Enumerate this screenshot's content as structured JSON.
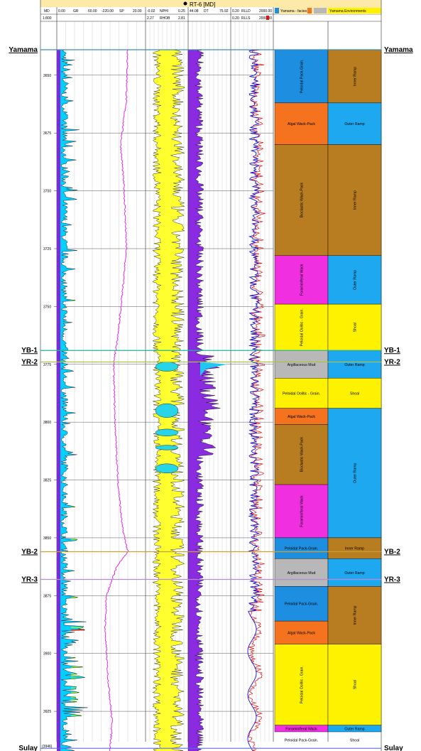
{
  "well": {
    "title": "RT-6 [MD]"
  },
  "header": {
    "md": "MD",
    "scale": "1:800",
    "gr_min": "0.00",
    "gr_name": "GR",
    "gr_max": "60.00",
    "sp_min": "-220.00",
    "sp_name": "SP",
    "sp_max": "20.00",
    "nphi_min": "-0.02",
    "nphi_name": "NPHI",
    "nphi_max": "0.25",
    "rhob_min": "2.27",
    "rhob_name": "RHOB",
    "rhob_max": "2.81",
    "dt_min": "44.08",
    "dt_name": "DT",
    "dt_max": "75.92",
    "rd_min": "0.20",
    "rd_name": "RLLD",
    "rd_max": "2000.00",
    "rs_min": "0.20",
    "rs_name": "RLLS",
    "rs_max": "2000.00",
    "facies_title": "Yamama - facies",
    "env_title": "Yamama Environments"
  },
  "depth_ticks": [
    "3650",
    "3675",
    "3700",
    "3725",
    "3750",
    "3775",
    "3800",
    "3825",
    "3850",
    "3875",
    "3900",
    "3925"
  ],
  "bottom_depth": "(3946)",
  "tops": [
    {
      "name": "Yamama",
      "depth": 3639,
      "color": "#3a8fb0"
    },
    {
      "name": "YB-1",
      "depth": 3769,
      "color": "#21b59a"
    },
    {
      "name": "YR-2",
      "depth": 3774,
      "color": "#a6c24a"
    },
    {
      "name": "YB-2",
      "depth": 3856,
      "color": "#c9a033"
    },
    {
      "name": "YR-3",
      "depth": 3868,
      "color": "#b58ad6"
    },
    {
      "name": "Sulay",
      "depth": 3941,
      "color": "#5b6be0"
    }
  ],
  "facies": [
    {
      "label": "Peloidal Pack-Grain.",
      "from": 3639,
      "to": 3662,
      "color": "#1e8fe0"
    },
    {
      "label": "Algal Wack-Pack",
      "from": 3662,
      "to": 3680,
      "color": "#f5731f"
    },
    {
      "label": "Bioclastic Wack-Pack",
      "from": 3680,
      "to": 3728,
      "color": "#b87d21"
    },
    {
      "label": "Foraminiferal Wack",
      "from": 3728,
      "to": 3749,
      "color": "#ef2fe0"
    },
    {
      "label": "Peloidal Oolitic - Grain.",
      "from": 3749,
      "to": 3769,
      "color": "#fff200"
    },
    {
      "label": "Argillaceous Mud",
      "from": 3769,
      "to": 3781,
      "color": "#b8b8b8"
    },
    {
      "label": "Peloidal Oolitic - Grain.",
      "from": 3781,
      "to": 3794,
      "color": "#fff200"
    },
    {
      "label": "Algal Wack-Pack",
      "from": 3794,
      "to": 3801,
      "color": "#f5731f"
    },
    {
      "label": "Bioclastic Wack-Pack",
      "from": 3801,
      "to": 3827,
      "color": "#b87d21"
    },
    {
      "label": "Foraminiferal Wack",
      "from": 3827,
      "to": 3850,
      "color": "#ef2fe0"
    },
    {
      "label": "Peloidal Pack-Grain.",
      "from": 3850,
      "to": 3859,
      "color": "#1e8fe0"
    },
    {
      "label": "Argillaceous Mud",
      "from": 3859,
      "to": 3871,
      "color": "#b8b8b8"
    },
    {
      "label": "Peloidal Pack-Grain.",
      "from": 3871,
      "to": 3886,
      "color": "#1e8fe0"
    },
    {
      "label": "Algal Wack-Pack",
      "from": 3886,
      "to": 3896,
      "color": "#f5731f"
    },
    {
      "label": "Peloidal Oolitic - Grain.",
      "from": 3896,
      "to": 3931,
      "color": "#fff200"
    },
    {
      "label": "Foraminiferal Wack",
      "from": 3931,
      "to": 3941,
      "color": "#ef2fe0"
    },
    {
      "label": "Peloidal Pack-Grain.",
      "from": 3941,
      "to": 3950,
      "color": "#1e8fe0"
    }
  ],
  "environments": [
    {
      "label": "Inner Ramp",
      "from": 3639,
      "to": 3662,
      "color": "#b87d21"
    },
    {
      "label": "Outer Ramp",
      "from": 3662,
      "to": 3680,
      "color": "#1ea8f0"
    },
    {
      "label": "Inner Ramp",
      "from": 3680,
      "to": 3728,
      "color": "#b87d21"
    },
    {
      "label": "Outer Ramp",
      "from": 3728,
      "to": 3749,
      "color": "#1ea8f0"
    },
    {
      "label": "Shoal",
      "from": 3749,
      "to": 3769,
      "color": "#fff200"
    },
    {
      "label": "Outer Ramp",
      "from": 3769,
      "to": 3781,
      "color": "#1ea8f0"
    },
    {
      "label": "Shoal",
      "from": 3781,
      "to": 3794,
      "color": "#fff200"
    },
    {
      "label": "Outer Ramp",
      "from": 3794,
      "to": 3850,
      "color": "#1ea8f0"
    },
    {
      "label": "Inner Ramp",
      "from": 3850,
      "to": 3859,
      "color": "#b87d21"
    },
    {
      "label": "Outer Ramp",
      "from": 3859,
      "to": 3871,
      "color": "#1ea8f0"
    },
    {
      "label": "Inner Ramp",
      "from": 3871,
      "to": 3896,
      "color": "#b87d21"
    },
    {
      "label": "Shoal",
      "from": 3896,
      "to": 3931,
      "color": "#fff200"
    },
    {
      "label": "Outer Ramp",
      "from": 3931,
      "to": 3941,
      "color": "#1ea8f0"
    },
    {
      "label": "Shoal",
      "from": 3941,
      "to": 3950,
      "color": "#fff200"
    }
  ],
  "colors": {
    "header_band": "#fde9a8",
    "gr_fill_low": "#00cfff",
    "gr_fill_mid": "#7cff4f",
    "gr_fill_high": "#ff2a00",
    "gr_fill_base": "#7b2bd9",
    "sp_curve": "#e030e0",
    "nphi_fill": "#ffff30",
    "nphi_cross": "#27d4e8",
    "dt_fill": "#8a2be2",
    "dt_fill_hi": "#1ec8f0",
    "rd_curve": "#e01010",
    "rs_curve": "#1414d8"
  }
}
